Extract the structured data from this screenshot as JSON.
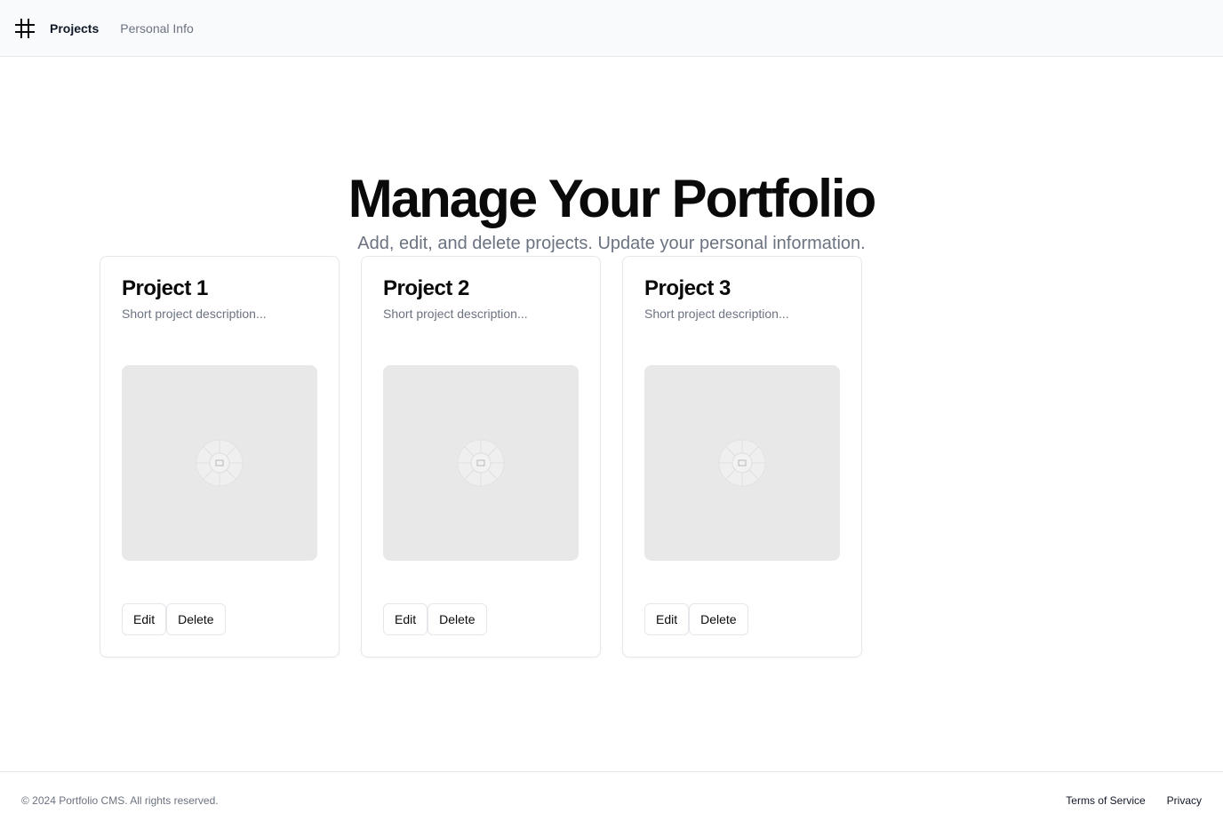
{
  "nav": {
    "logo_icon": "hash-icon",
    "items": [
      {
        "label": "Projects",
        "active": true
      },
      {
        "label": "Personal Info",
        "active": false
      }
    ]
  },
  "hero": {
    "title": "Manage Your Portfolio",
    "subtitle": "Add, edit, and delete projects. Update your personal information."
  },
  "projects": [
    {
      "title": "Project 1",
      "description": "Short project description...",
      "image_icon": "image-placeholder-icon",
      "edit_label": "Edit",
      "delete_label": "Delete"
    },
    {
      "title": "Project 2",
      "description": "Short project description...",
      "image_icon": "image-placeholder-icon",
      "edit_label": "Edit",
      "delete_label": "Delete"
    },
    {
      "title": "Project 3",
      "description": "Short project description...",
      "image_icon": "image-placeholder-icon",
      "edit_label": "Edit",
      "delete_label": "Delete"
    }
  ],
  "footer": {
    "copyright": "© 2024 Portfolio CMS. All rights reserved.",
    "links": [
      "Terms of Service",
      "Privacy"
    ]
  },
  "colors": {
    "text": "#0a0a0a",
    "muted": "#6b7280",
    "border": "#e5e7eb",
    "placeholder_bg": "#e8e8e8",
    "topbar_bg": "#f9fafb"
  }
}
